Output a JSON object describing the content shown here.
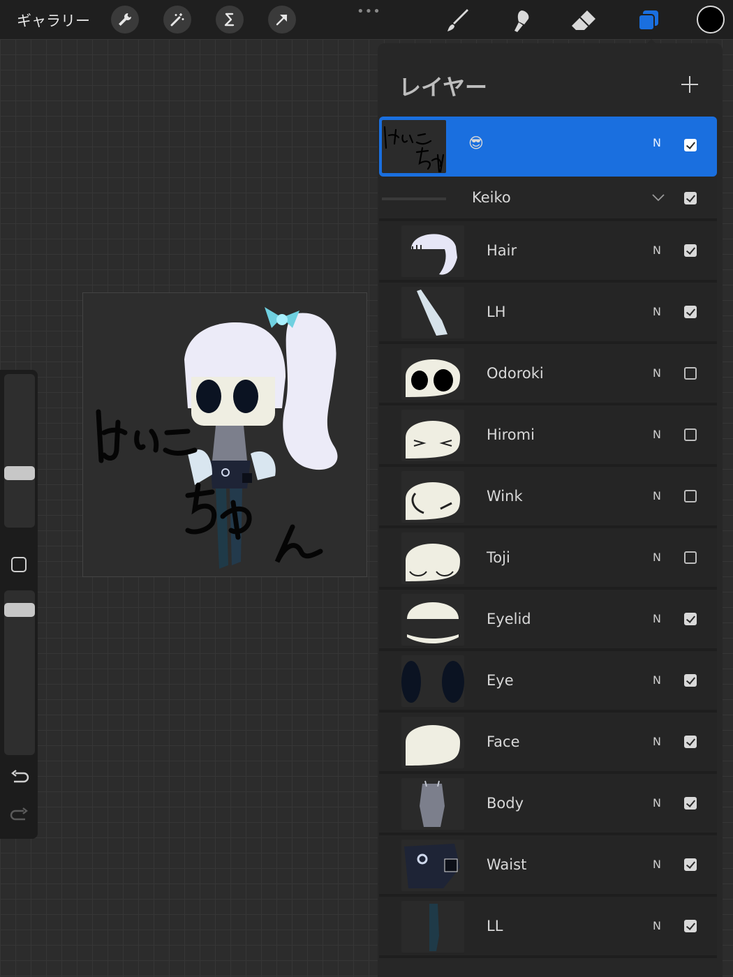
{
  "topbar": {
    "gallery_label": "ギャラリー",
    "tools": [
      "wrench-icon",
      "magic-wand-icon",
      "selection-icon",
      "transform-arrow-icon"
    ],
    "more_label": "•••",
    "right_tools": [
      "brush-icon",
      "smudge-icon",
      "eraser-icon",
      "layers-icon"
    ],
    "current_color": "#000000",
    "accent": "#1a6fdf"
  },
  "artwork": {
    "text_lines": [
      "けいこ",
      "ちゃん"
    ]
  },
  "layers": {
    "title": "レイヤー",
    "add_label": "+",
    "selected_layer": {
      "name": "😎",
      "blend": "N",
      "visible": true
    },
    "group": {
      "name": "Keiko",
      "visible": true,
      "expanded": true
    },
    "items": [
      {
        "name": "Hair",
        "blend": "N",
        "visible": true
      },
      {
        "name": "LH",
        "blend": "N",
        "visible": true
      },
      {
        "name": "Odoroki",
        "blend": "N",
        "visible": false
      },
      {
        "name": "Hiromi",
        "blend": "N",
        "visible": false
      },
      {
        "name": "Wink",
        "blend": "N",
        "visible": false
      },
      {
        "name": "Toji",
        "blend": "N",
        "visible": false
      },
      {
        "name": "Eyelid",
        "blend": "N",
        "visible": true
      },
      {
        "name": "Eye",
        "blend": "N",
        "visible": true
      },
      {
        "name": "Face",
        "blend": "N",
        "visible": true
      },
      {
        "name": "Body",
        "blend": "N",
        "visible": true
      },
      {
        "name": "Waist",
        "blend": "N",
        "visible": true
      },
      {
        "name": "LL",
        "blend": "N",
        "visible": true
      }
    ]
  }
}
